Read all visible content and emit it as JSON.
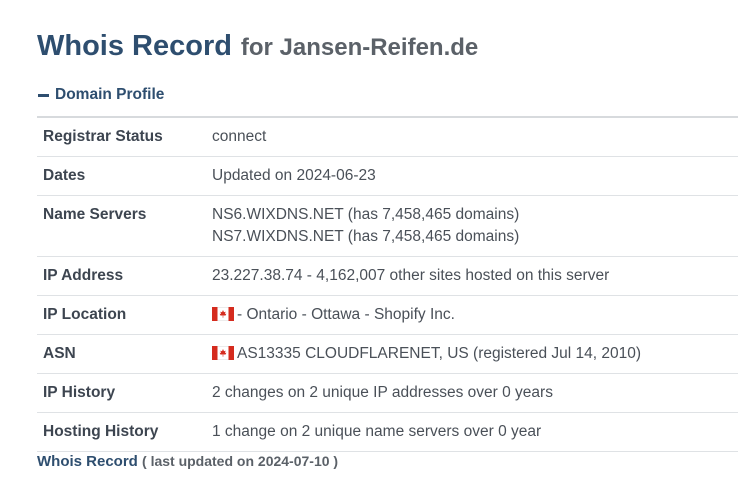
{
  "header": {
    "title_main": "Whois Record",
    "title_for": "for Jansen-Reifen.de"
  },
  "section": {
    "toggle_icon": "minus-icon",
    "label": "Domain Profile"
  },
  "rows": [
    {
      "label": "Registrar Status",
      "lines": [
        "connect"
      ]
    },
    {
      "label": "Dates",
      "lines": [
        "Updated on 2024-06-23"
      ]
    },
    {
      "label": "Name Servers",
      "lines": [
        "NS6.WIXDNS.NET (has 7,458,465 domains)",
        "NS7.WIXDNS.NET (has 7,458,465 domains)"
      ]
    },
    {
      "label": "IP Address",
      "lines": [
        "23.227.38.74 - 4,162,007 other sites hosted on this server"
      ]
    },
    {
      "label": "IP Location",
      "flag": "canada-flag-icon",
      "lines": [
        "- Ontario - Ottawa - Shopify Inc."
      ]
    },
    {
      "label": "ASN",
      "flag": "canada-flag-icon",
      "lines": [
        "AS13335 CLOUDFLARENET, US (registered Jul 14, 2010)"
      ]
    },
    {
      "label": "IP History",
      "lines": [
        "2 changes on 2 unique IP addresses over 0 years"
      ]
    },
    {
      "label": "Hosting History",
      "lines": [
        "1 change on 2 unique name servers over 0 year"
      ]
    }
  ],
  "footer": {
    "link": "Whois Record",
    "updated": "( last updated on 2024-07-10 )"
  },
  "colors": {
    "accent": "#2e4e6f",
    "text": "#3d4550",
    "border": "#dfe2e5",
    "flag_red": "#d52b1e"
  }
}
